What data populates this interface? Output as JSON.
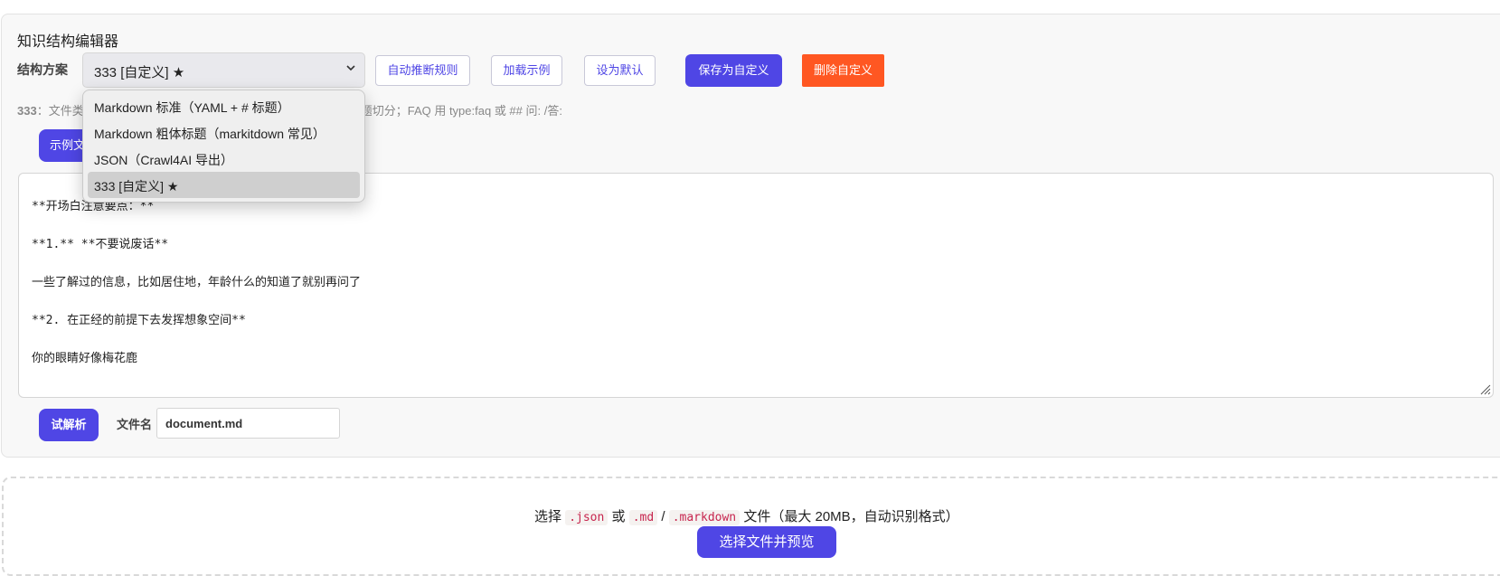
{
  "editor": {
    "title": "知识结构编辑器",
    "scheme_label": "结构方案",
    "scheme_selected": "333 [自定义] ★",
    "buttons": {
      "auto_infer": "自动推断规则",
      "load_example": "加载示例",
      "set_default": "设为默认",
      "save_custom": "保存为自定义",
      "delete_custom": "删除自定义"
    },
    "hint_name": "333",
    "hint_prefix": "：文件类",
    "hint_suffix": "题切分；FAQ 用 type:faq 或 ## 问: /答:",
    "example_button": "示例文",
    "dropdown_options": [
      "Markdown 标准（YAML + # 标题）",
      "Markdown 粗体标题（markitdown 常见）",
      "JSON（Crawl4AI 导出）",
      "333 [自定义] ★"
    ],
    "text_lines": [
      "**开场白注意要点：**",
      "**1.** **不要说废话**",
      "一些了解过的信息，比如居住地，年龄什么的知道了就别再问了",
      "**2. 在正经的前提下去发挥想象空间**",
      "你的眼睛好像梅花鹿"
    ],
    "parse_button": "试解析",
    "filename_label": "文件名",
    "filename_value": "document.md"
  },
  "upload": {
    "text_before": "选择",
    "ext_json": ".json",
    "or": "或",
    "ext_md": ".md",
    "slash": "/",
    "ext_markdown": ".markdown",
    "text_after": "文件（最大 20MB，自动识别格式）",
    "button": "选择文件并预览"
  },
  "colors": {
    "primary": "#4f46e5",
    "danger": "#ff5722"
  },
  "icons": [
    "chevron-down-icon",
    "resize-grip-icon"
  ]
}
